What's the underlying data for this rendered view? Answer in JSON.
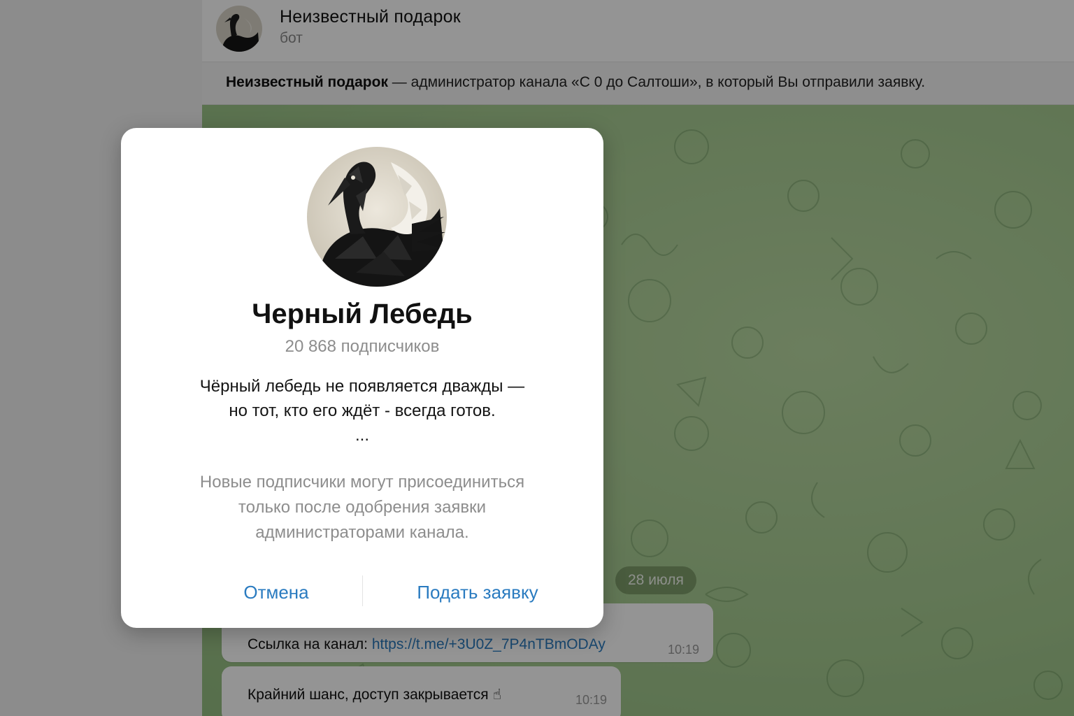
{
  "chat": {
    "title": "Неизвестный подарок",
    "subtitle": "бот",
    "info_bold": "Неизвестный подарок",
    "info_rest": " — администратор канала «С 0 до Салтоши», в который Вы отправили заявку.",
    "date": "28 июля",
    "messages": [
      {
        "prefix": "Ссылка на канал: ",
        "link": "https://t.me/+3U0Z_7P4nTBmODAy",
        "time": "10:19"
      },
      {
        "text": "Крайний шанс, доступ закрывается ☝",
        "time": "10:19"
      }
    ]
  },
  "modal": {
    "channel_name": "Черный Лебедь",
    "subscribers": "20 868 подписчиков",
    "description": [
      "Чёрный лебедь не появляется дважды —",
      "но тот, кто его ждёт - всегда готов.",
      "..."
    ],
    "note": [
      "Новые подписчики могут присоединиться",
      "только после одобрения заявки",
      "администраторами канала."
    ],
    "cancel_label": "Отмена",
    "apply_label": "Подать заявку"
  },
  "colors": {
    "accent": "#2a7bc0",
    "chat_background": "#a7cc92",
    "date_pill": "#5c7848"
  },
  "icons": {
    "avatar": "black-swan-avatar",
    "emoji": "pointing-up-emoji"
  }
}
